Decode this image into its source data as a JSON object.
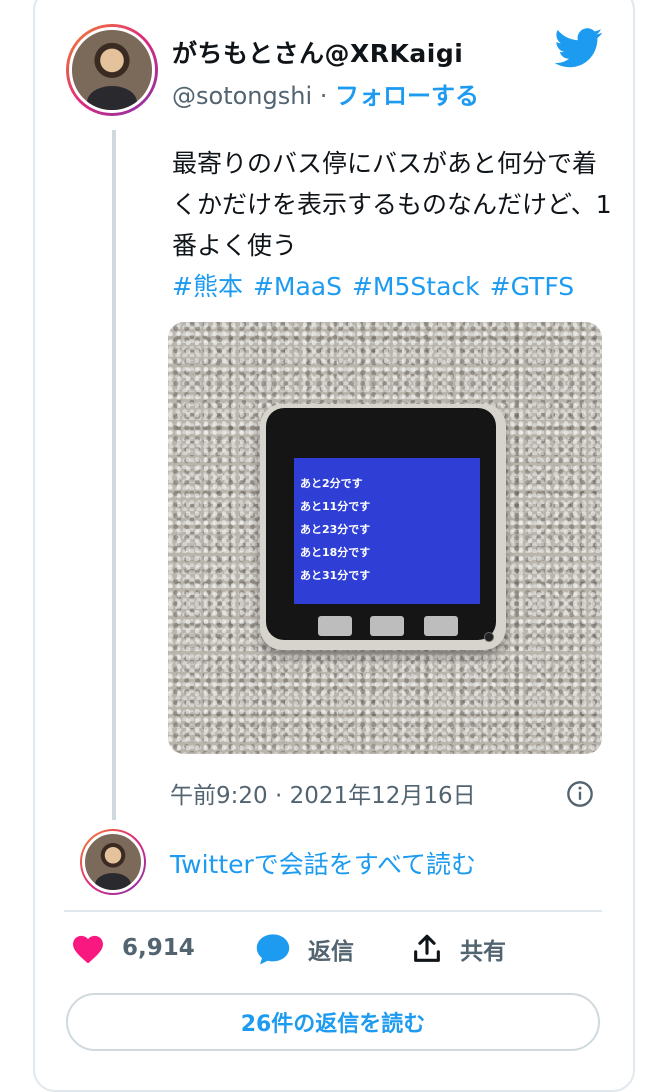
{
  "author": {
    "display_name": "がちもとさん@XRKaigi",
    "handle": "@sotongshi",
    "separator": " · ",
    "follow_label": "フォローする"
  },
  "tweet": {
    "text": "最寄りのバス停にバスがあと何分で着くかだけを表示するものなんだけど、1番よく使う",
    "hashtags": [
      "#熊本",
      "#MaaS",
      "#M5Stack",
      "#GTFS"
    ],
    "timestamp": "午前9:20 · 2021年12月16日"
  },
  "photo": {
    "screen_lines": [
      "あと2分です",
      "あと11分です",
      "あと23分です",
      "あと18分です",
      "あと31分です"
    ]
  },
  "conversation_link": "Twitterで会話をすべて読む",
  "actions": {
    "likes": "6,914",
    "reply_label": "返信",
    "share_label": "共有"
  },
  "replies_button": "26件の返信を読む",
  "colors": {
    "accent": "#1d9bf0",
    "like": "#f91880",
    "secondary_text": "#536471",
    "screen_blue": "#2f3fd6"
  }
}
